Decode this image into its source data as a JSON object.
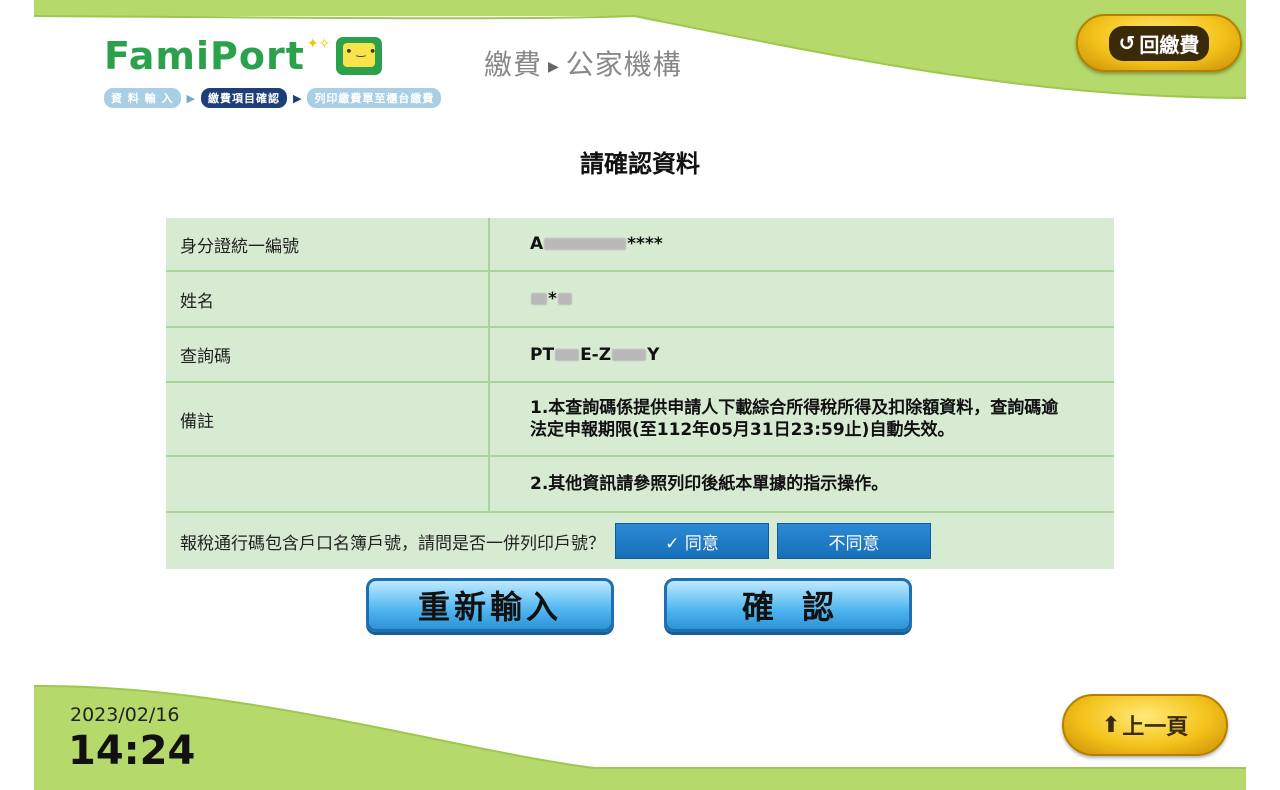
{
  "header": {
    "logo_text": "FamiPort",
    "breadcrumb_main": "繳費",
    "breadcrumb_sub": "公家機構",
    "back_button": "回繳費",
    "steps": [
      {
        "label": "資 料 輸 入",
        "active": false
      },
      {
        "label": "繳費項目確認",
        "active": true
      },
      {
        "label": "列印繳費單至櫃台繳費",
        "active": false
      }
    ]
  },
  "title": "請確認資料",
  "fields": [
    {
      "label": "身分證統一編號",
      "value_prefix": "A",
      "value_suffix": "****"
    },
    {
      "label": "姓名",
      "value_middle": "*"
    },
    {
      "label": "查詢碼",
      "value_prefix": "PT",
      "value_mid": "E-Z",
      "value_suffix": "Y"
    },
    {
      "label": "備註",
      "value": "1.本查詢碼係提供申請人下載綜合所得稅所得及扣除額資料，查詢碼逾法定申報期限(至112年05月31日23:59止)自動失效。"
    },
    {
      "label": "",
      "value": "2.其他資訊請參照列印後紙本單據的指示操作。"
    }
  ],
  "consent": {
    "question": "報稅通行碼包含戶口名簿戶號，請問是否一併列印戶號？",
    "agree_label": "✓ 同意",
    "disagree_label": "不同意"
  },
  "actions": {
    "reenter_label": "重新輸入",
    "confirm_label": "確認"
  },
  "footer": {
    "date": "2023/02/16",
    "time": "14:24",
    "prev_label": "上一頁"
  },
  "colors": {
    "brand_green": "#2aa14a",
    "band_green": "#b5d96a",
    "table_bg": "#d7ebd3",
    "button_blue": "#176fb8"
  }
}
